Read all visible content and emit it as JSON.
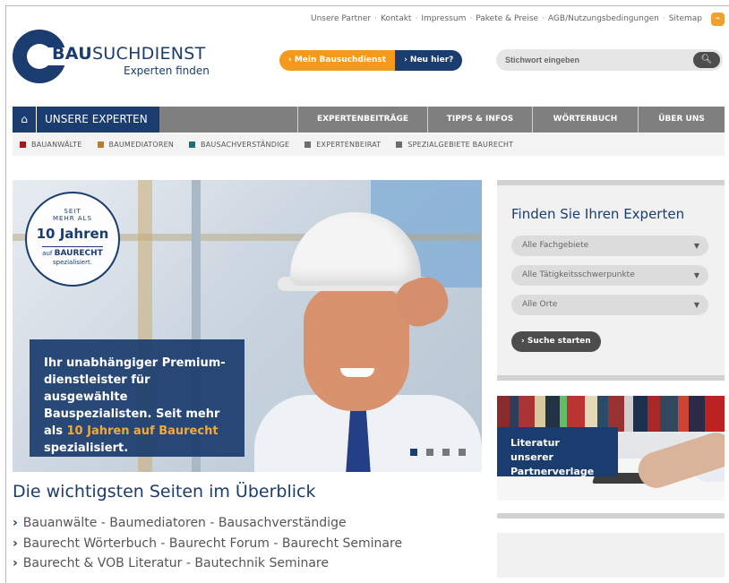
{
  "toplinks": [
    "Unsere Partner",
    "Kontakt",
    "Impressum",
    "Pakete & Preise",
    "AGB/Nutzungsbedingungen",
    "Sitemap"
  ],
  "toplinks_separator": "·",
  "logo": {
    "brand_bold": "BAU",
    "brand_rest": "SUCHDIENST",
    "tagline": "Experten finden"
  },
  "header_buttons": {
    "my_label": "› Mein Bausuchdienst",
    "new_label": "› Neu hier?"
  },
  "search": {
    "placeholder": "Stichwort eingeben",
    "icon": "search-icon"
  },
  "nav": {
    "home_icon": "home-icon",
    "home_glyph": "⌂",
    "experts_label": "UNSERE EXPERTEN",
    "items": [
      {
        "label": "EXPERTENBEITRÄGE"
      },
      {
        "label": "TIPPS & INFOS"
      },
      {
        "label": "WÖRTERBUCH"
      },
      {
        "label": "ÜBER UNS"
      }
    ]
  },
  "subnav": [
    {
      "label": "BAUANWÄLTE",
      "color": "#a3171f"
    },
    {
      "label": "BAUMEDIATOREN",
      "color": "#c07a26"
    },
    {
      "label": "BAUSACHVERSTÄNDIGE",
      "color": "#19707a"
    },
    {
      "label": "EXPERTENBEIRAT",
      "color": "#6d6d6d"
    },
    {
      "label": "SPEZIALGEBIETE BAURECHT",
      "color": "#6d6d6d"
    }
  ],
  "hero": {
    "badge": {
      "line1": "SEIT",
      "line2": "MEHR ALS",
      "line3": "10 Jahren",
      "line4_prefix": "auf",
      "line4_bold": "BAURECHT",
      "line5": "spezialisiert."
    },
    "text_part1": "Ihr unabhängiger Premium-dienstleister für ausgewählte Bauspezialisten. Seit mehr als",
    "text_highlight": "10 Jahren auf Baurecht",
    "text_part2": "spezialisiert.",
    "slide_count": 4,
    "active_slide": 1
  },
  "overview": {
    "title": "Die wichtigsten Seiten im Überblick",
    "lines": [
      [
        "Bauanwälte",
        "Baumediatoren",
        "Bausachverständige"
      ],
      [
        "Baurecht Wörterbuch",
        "Baurecht Forum",
        "Baurecht Seminare"
      ],
      [
        "Baurecht & VOB Literatur",
        "Bautechnik Seminare"
      ]
    ],
    "separator": "-",
    "bullet": "›"
  },
  "finder": {
    "title": "Finden Sie Ihren Experten",
    "selects": [
      "Alle Fachgebiete",
      "Alle Tätigkeitsschwerpunkte",
      "Alle Orte"
    ],
    "button_label": "› Suche starten"
  },
  "literature": {
    "label_line1": "Literatur unserer",
    "label_line2": "Partnerverlage"
  },
  "colors": {
    "navy": "#1b3c6e",
    "orange": "#f39a1c",
    "nav_grey": "#7f7f7f"
  }
}
